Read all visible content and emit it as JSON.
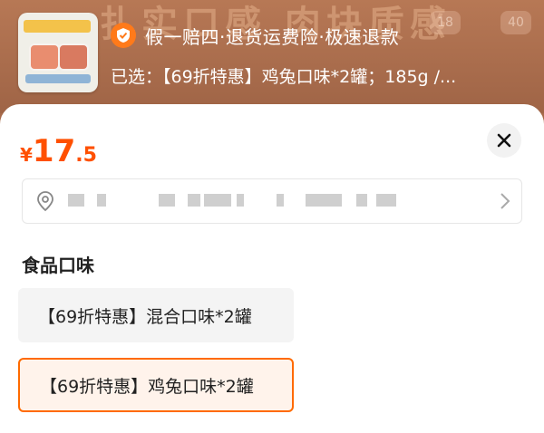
{
  "background": {
    "ghost_text": "扎实口感 肉块质感",
    "chips": [
      "18",
      "40"
    ]
  },
  "product": {
    "thumbnail_icon": "product-thumbnail"
  },
  "guarantee": {
    "icon": "shield-check-icon",
    "text": "假一赔四·退货运费险·极速退款"
  },
  "selected": {
    "text": "已选：【69折特惠】鸡兔口味*2罐；185g /..."
  },
  "price": {
    "currency": "¥",
    "integer": "17",
    "decimal": ".5"
  },
  "address": {
    "icon": "location-pin-icon",
    "chevron": "chevron-right-icon"
  },
  "section": {
    "title": "食品口味"
  },
  "options": [
    {
      "label": "【69折特惠】混合口味*2罐",
      "selected": false
    },
    {
      "label": "【69折特惠】鸡兔口味*2罐",
      "selected": true
    }
  ],
  "colors": {
    "accent": "#ff5000",
    "selected_border": "#ff6a00"
  }
}
